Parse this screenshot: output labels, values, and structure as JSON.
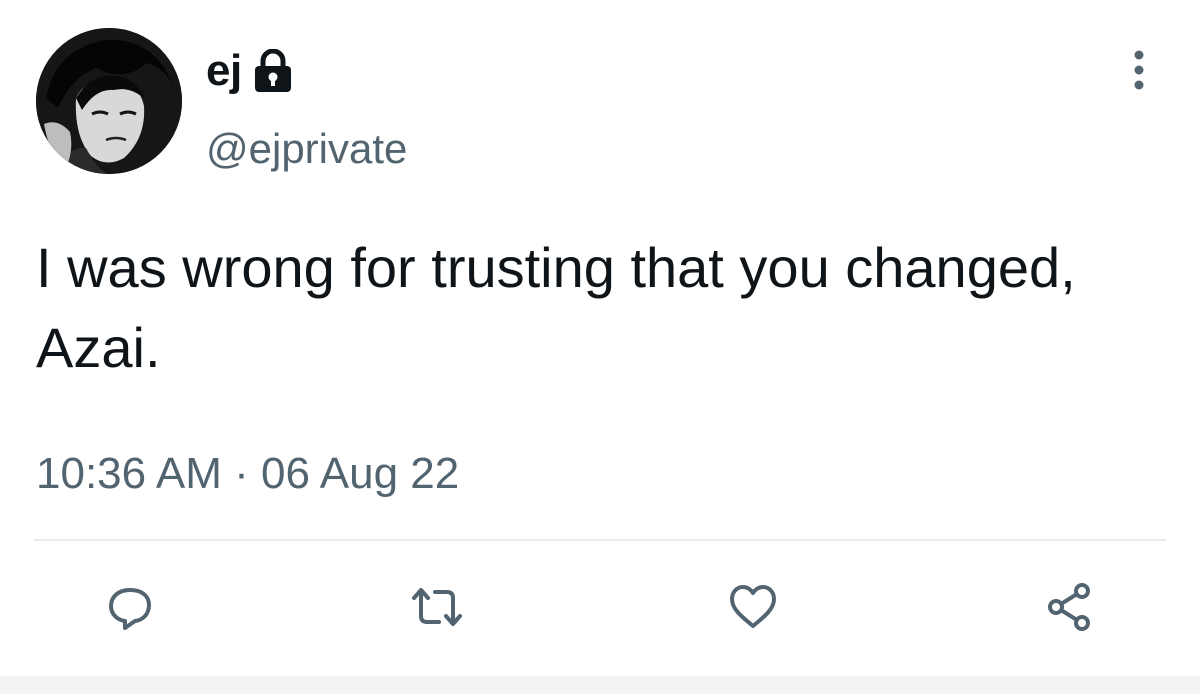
{
  "author": {
    "display_name": "ej",
    "handle": "@ejprivate",
    "protected": true,
    "avatar": "avatar-image"
  },
  "tweet": {
    "text": "I was wrong for trusting that you changed, Azai.",
    "timestamp": "10:36 AM · 06 Aug 22"
  },
  "icons": {
    "lock": "lock-icon",
    "more": "more-vertical-icon",
    "reply": "reply-icon",
    "retweet": "retweet-icon",
    "like": "heart-icon",
    "share": "share-icon"
  },
  "colors": {
    "text_primary": "#0f1419",
    "text_secondary": "#536471",
    "icon": "#536471",
    "divider": "#e6ecf0",
    "background": "#ffffff"
  }
}
